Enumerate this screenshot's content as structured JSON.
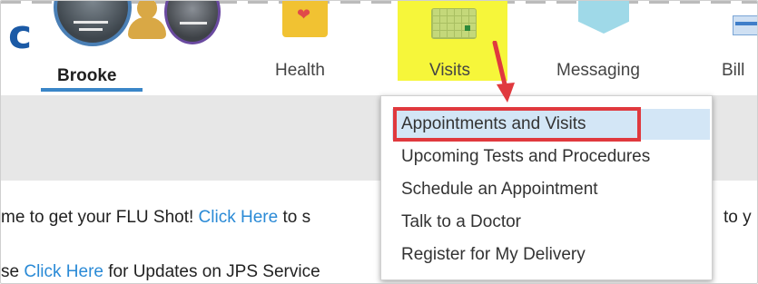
{
  "nav": {
    "profile_name": "Brooke",
    "tabs": [
      {
        "label": "Health",
        "icon": "heart-icon"
      },
      {
        "label": "Visits",
        "icon": "calendar-icon"
      },
      {
        "label": "Messaging",
        "icon": "envelope-icon"
      },
      {
        "label": "Bill",
        "icon": "billing-icon"
      }
    ],
    "highlight_color": "#f6f63a"
  },
  "dropdown": {
    "items": [
      {
        "label": "Appointments and Visits",
        "active": true
      },
      {
        "label": "Upcoming Tests and Procedures",
        "active": false
      },
      {
        "label": "Schedule an Appointment",
        "active": false
      },
      {
        "label": "Talk to a Doctor",
        "active": false
      },
      {
        "label": "Register for My Delivery",
        "active": false
      }
    ],
    "annotation_color": "#e0393e"
  },
  "body": {
    "line1_prefix": "me to get your FLU Shot! ",
    "line1_link": "Click Here",
    "line1_suffix": " to s",
    "line1_right": "to y",
    "line2_prefix": "se ",
    "line2_link": "Click Here",
    "line2_suffix": " for Updates on JPS Service",
    "link_color": "#2a8ad6"
  }
}
